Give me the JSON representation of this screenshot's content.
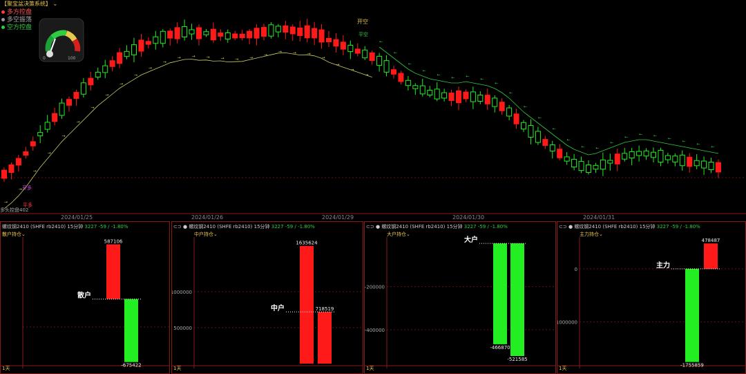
{
  "window_title": "【聚宝盆决策系统】",
  "legend": [
    {
      "label": "多方控盘",
      "color": "#ff3b3b"
    },
    {
      "label": "多空振荡",
      "color": "#cccccc"
    },
    {
      "label": "空方控盘",
      "color": "#2ecc40"
    }
  ],
  "gauge": {
    "min_label": "0",
    "max_label": "100",
    "value": 0.15
  },
  "main_chart": {
    "dates": [
      "2024/01/25",
      "2024/01/26",
      "2024/01/29",
      "2024/01/30",
      "2024/01/31"
    ],
    "labels": {
      "open_short": "开空",
      "close_short": "平空",
      "open_long": "开多",
      "close_long": "平多",
      "side_note": "多头控盘402"
    }
  },
  "chart_data": [
    {
      "type": "bar",
      "symbol": "螺纹钢2410",
      "exchange": "SHFE rb2410",
      "period": "15分钟",
      "price": "3227",
      "change": "-59 / -1.80%",
      "indicator": "散户持仓",
      "marker": "散户",
      "footer": "1天",
      "y_ticks": [],
      "series": [
        {
          "value": 587106,
          "color": "#ff1a1a"
        },
        {
          "value": -675422,
          "color": "#22ee22"
        }
      ]
    },
    {
      "type": "bar",
      "symbol": "螺纹钢2410",
      "exchange": "SHFE rb2410",
      "period": "15分钟",
      "price": "3227",
      "change": "-59 / -1.80%",
      "indicator": "中户持仓",
      "marker": "中户",
      "footer": "1天",
      "y_ticks": [
        "1000000",
        "500000"
      ],
      "series": [
        {
          "value": 1635624,
          "color": "#ff1a1a"
        },
        {
          "value": 718519,
          "color": "#ff1a1a"
        }
      ]
    },
    {
      "type": "bar",
      "symbol": "螺纹钢2410",
      "exchange": "SHFE rb2410",
      "period": "15分钟",
      "price": "3227",
      "change": "-59 / -1.80%",
      "indicator": "大户持仓",
      "marker": "大户",
      "footer": "1天",
      "y_ticks": [
        "-200000",
        "-400000"
      ],
      "series": [
        {
          "value": -466870,
          "color": "#22ee22"
        },
        {
          "value": -521585,
          "color": "#22ee22"
        }
      ]
    },
    {
      "type": "bar",
      "symbol": "螺纹钢2410",
      "exchange": "SHFE rb2410",
      "period": "15分钟",
      "price": "3227",
      "change": "-59 / -1.80%",
      "indicator": "主力持仓",
      "marker": "主力",
      "footer": "1天",
      "y_ticks": [
        "0",
        "1000000"
      ],
      "series": [
        {
          "value": -1755859,
          "color": "#22ee22"
        },
        {
          "value": 478487,
          "color": "#ff1a1a"
        }
      ]
    }
  ]
}
